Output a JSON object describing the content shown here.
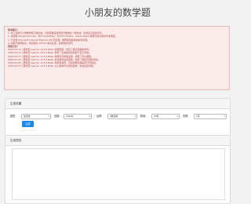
{
  "app": {
    "title": "小朋友的数学题"
  },
  "notice": {
    "usage_header": "使用提示:",
    "usage": [
      "1. 本工具用于小学数学练习题生成，可按需要设置题型与数量后一键生成，生成后可直接打印。",
      "2. 请使用 Google Chrome、Microsoft Edge、Mozilla Firefox、Apple Safari 等现代浏览器访问本页面。",
      "3. 不支持 Microsoft Internet Explorer(IE) 浏览器，推荐使用最新版本浏览器。",
      "4. 如有问题或建议，欢迎通过 GitHub 提交反馈，感谢您的支持。"
    ],
    "log_header": "更新日志:",
    "logs": [
      "2023-03-12 | 更新至 Learner v0.5.0 Beta, 新增题型，优化了部分页面的布局。",
      "2023-03-14 | 更新至 Learner v0.5.1 Beta, 修复了生成题目时的若干显示问题。",
      "2023-03-17 | 更新至 Learner v0.5.2 Beta, 新增打印排版设置，调整了默认参数。",
      "2023-03-21 | 更新至 Learner v0.5.3 Beta, 优化题目生成逻辑，修复了数值范围的问题。",
      "2023-04-05 | 更新至 Learner v0.5.4 Beta, 新增答案页，可按需要选择是否打印答案。",
      "2023-04-23 | 更新至 Learner v0.5.5 Beta, 以上版本均为测试版本，欢迎反馈问题。"
    ]
  },
  "settings": {
    "panel_title": "生成设置",
    "fields": [
      {
        "label": "题型:",
        "value": "加法题"
      },
      {
        "label": "范围:",
        "value": "10以内"
      },
      {
        "label": "运算:",
        "value": "2数运算"
      },
      {
        "label": "数量:",
        "value": "50道"
      },
      {
        "label": "页数:",
        "value": "1页"
      }
    ],
    "generate_label": "生成"
  },
  "preview": {
    "panel_title": "生成预览"
  }
}
